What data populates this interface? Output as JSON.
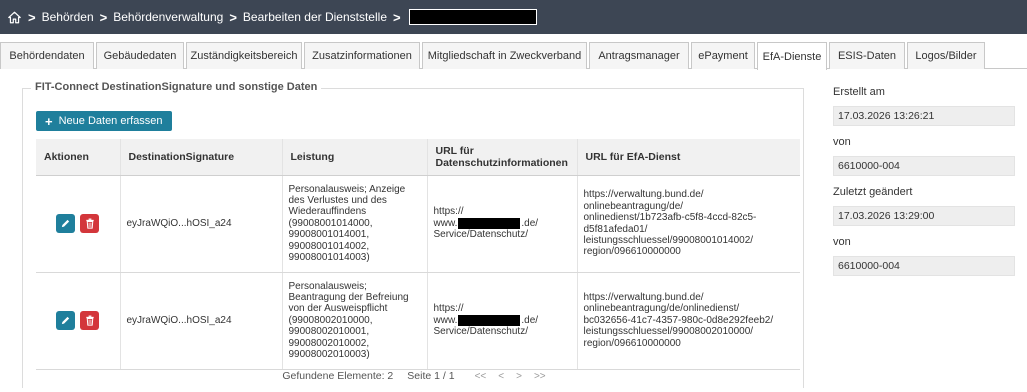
{
  "breadcrumb": {
    "items": [
      "Behörden",
      "Behördenverwaltung",
      "Bearbeiten der Dienststelle"
    ]
  },
  "tabs": [
    {
      "label": "Behördendaten",
      "active": false
    },
    {
      "label": "Gebäudedaten",
      "active": false
    },
    {
      "label": "Zuständigkeitsbereich",
      "active": false
    },
    {
      "label": "Zusatzinformationen",
      "active": false
    },
    {
      "label": "Mitgliedschaft in Zweckverband",
      "active": false
    },
    {
      "label": "Antragsmanager",
      "active": false
    },
    {
      "label": "ePayment",
      "active": false
    },
    {
      "label": "EfA-Dienste",
      "active": true
    },
    {
      "label": "ESIS-Daten",
      "active": false
    },
    {
      "label": "Logos/Bilder",
      "active": false
    }
  ],
  "section": {
    "title": "FIT-Connect DestinationSignature und sonstige Daten",
    "new_button": "Neue Daten erfassen"
  },
  "table": {
    "headers": {
      "actions": "Aktionen",
      "signature": "DestinationSignature",
      "leistung": "Leistung",
      "url_privacy": "URL für Datenschutzinformationen",
      "url_efa": "URL für EfA-Dienst"
    },
    "rows": [
      {
        "signature": "eyJraWQiO...hOSI_a24",
        "leistung": "Personalausweis; Anzeige\ndes Verlustes und des\nWiederauffindens\n(99008001014000,\n99008001014001,\n99008001014002,\n99008001014003)",
        "url_privacy_1": "https://",
        "url_privacy_2a": "www.",
        "url_privacy_2b": ".de/",
        "url_privacy_3": "Service/Datenschutz/",
        "url_efa": "https://verwaltung.bund.de/\nonlinebeantragung/de/\nonlinedienst/1b723afb-c5f8-4ccd-82c5-\nd5f81afeda01/\nleistungsschluessel/99008001014002/\nregion/096610000000"
      },
      {
        "signature": "eyJraWQiO...hOSI_a24",
        "leistung": "Personalausweis;\nBeantragung der Befreiung\nvon der Ausweispflicht\n(99008002010000,\n99008002010001,\n99008002010002,\n99008002010003)",
        "url_privacy_1": "https://",
        "url_privacy_2a": "www.",
        "url_privacy_2b": ".de/",
        "url_privacy_3": "Service/Datenschutz/",
        "url_efa": "https://verwaltung.bund.de/\nonlinebeantragung/de/onlinedienst/\nbc032656-41c7-4357-980c-0d8e292feeb2/\nleistungsschluessel/99008002010000/\nregion/096610000000"
      }
    ]
  },
  "pagination": {
    "found": "Gefundene Elemente: 2",
    "page": "Seite 1 / 1",
    "first": "<<",
    "prev": "<",
    "next": ">",
    "last": ">>"
  },
  "meta": {
    "created_label": "Erstellt am",
    "created_value": "17.03.2026 13:26:21",
    "created_by_label": "von",
    "created_by_value": "6610000-004",
    "changed_label": "Zuletzt geändert",
    "changed_value": "17.03.2026 13:29:00",
    "changed_by_label": "von",
    "changed_by_value": "6610000-004"
  },
  "colors": {
    "breadcrumb_bg": "#3d4654",
    "primary": "#1f7f9c",
    "danger": "#d3363b"
  }
}
